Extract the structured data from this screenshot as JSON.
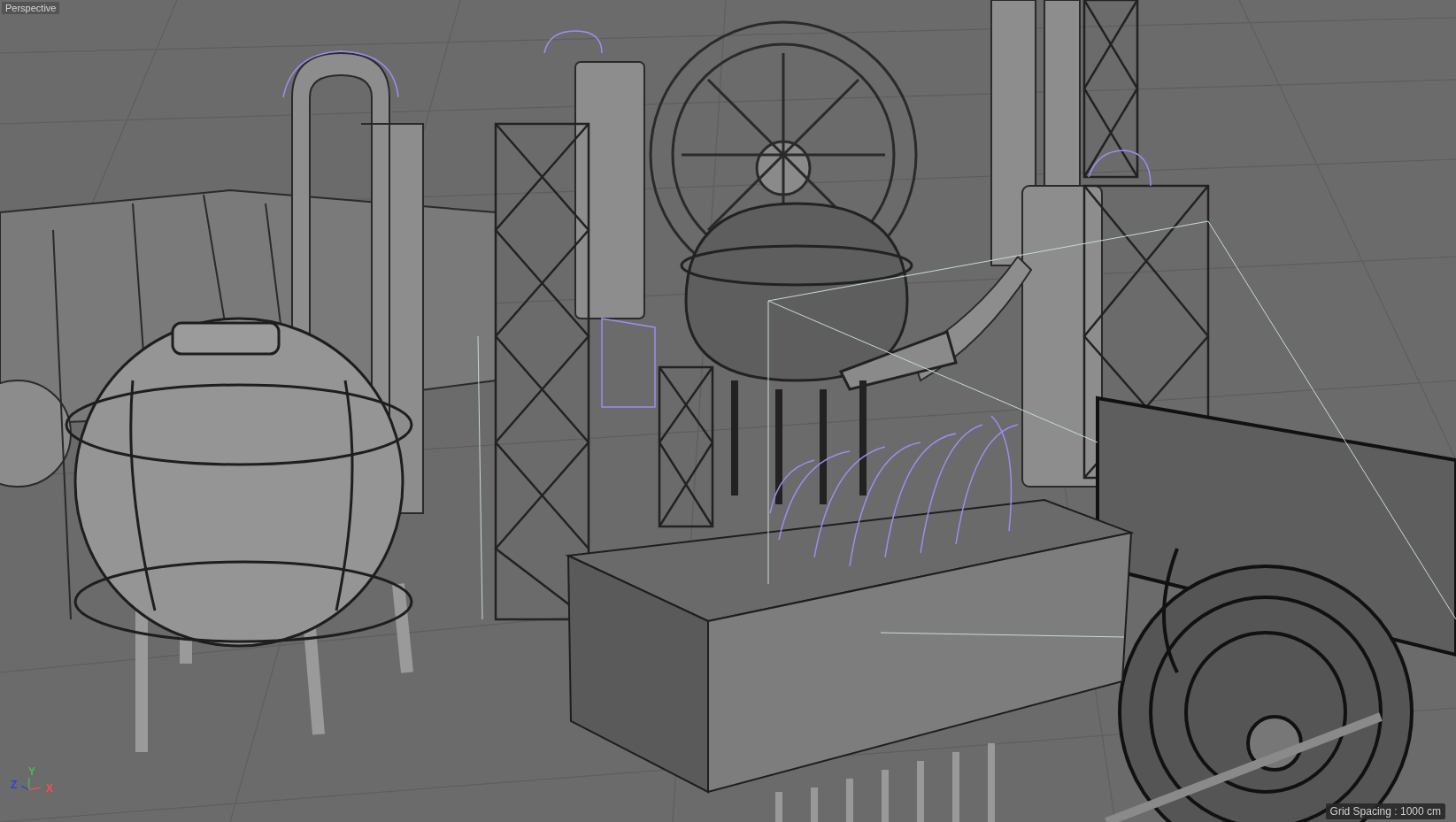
{
  "viewport": {
    "title": "Perspective",
    "grid_spacing": "Grid Spacing : 1000 cm",
    "axes": [
      {
        "label": "Y",
        "color": "#3ec43e"
      },
      {
        "label": "Z",
        "color": "#3a3ae0"
      },
      {
        "label": "X",
        "color": "#ff4c4c"
      }
    ]
  }
}
